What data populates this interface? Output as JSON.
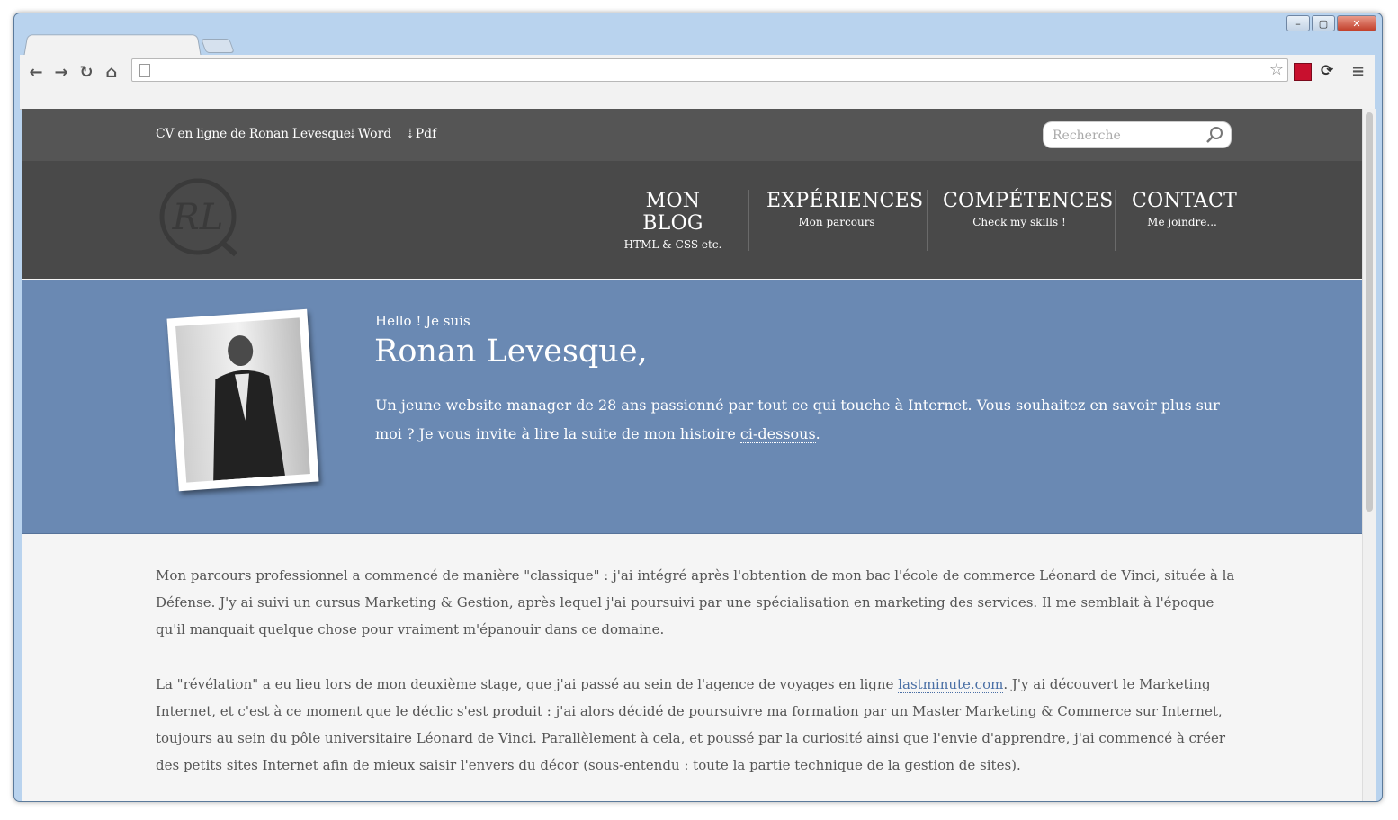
{
  "browser": {
    "window_controls": [
      "–",
      "▢",
      "✕"
    ],
    "url": ""
  },
  "topbar": {
    "cv_title": "CV en ligne de Ronan Levesque",
    "downloads": [
      {
        "label": "Word"
      },
      {
        "label": "Pdf"
      }
    ],
    "search_placeholder": "Recherche"
  },
  "nav": {
    "logo_text": "RL",
    "items": [
      {
        "title": "MON BLOG",
        "subtitle": "HTML & CSS etc."
      },
      {
        "title": "EXPÉRIENCES",
        "subtitle": "Mon parcours"
      },
      {
        "title": "COMPÉTENCES",
        "subtitle": "Check my skills !"
      },
      {
        "title": "CONTACT",
        "subtitle": "Me joindre..."
      }
    ]
  },
  "hero": {
    "greeting": "Hello ! Je suis",
    "name": "Ronan Levesque,",
    "intro_text": "Un jeune website manager de 28 ans passionné par tout ce qui touche à Internet. Vous souhaitez en savoir plus sur moi ? Je vous invite à lire la suite de mon histoire ",
    "intro_link": "ci-dessous",
    "intro_end": "."
  },
  "content": {
    "paragraph1": "Mon parcours professionnel a commencé de manière \"classique\" : j'ai intégré après l'obtention de mon bac l'école de commerce Léonard de Vinci, située à la Défense. J'y ai suivi un cursus Marketing & Gestion, après lequel j'ai poursuivi par une spécialisation en marketing des services. Il me semblait à l'époque qu'il manquait quelque chose pour vraiment m'épanouir dans ce domaine.",
    "paragraph2_start": "La \"révélation\" a eu lieu lors de mon deuxième stage, que j'ai passé au sein de l'agence de voyages en ligne ",
    "paragraph2_link": "lastminute.com",
    "paragraph2_end": ". J'y ai découvert le Marketing Internet, et c'est à ce moment que le déclic s'est produit : j'ai alors décidé de poursuivre ma formation par un Master Marketing & Commerce sur Internet, toujours au sein du pôle universitaire Léonard de Vinci. Parallèlement à cela, et poussé par la curiosité ainsi que l'envie d'apprendre, j'ai commencé à créer des petits sites Internet afin de mieux saisir l'envers du décor (sous-entendu : toute la partie technique de la gestion de sites)."
  },
  "colors": {
    "topbar": "#555555",
    "header": "#494949",
    "hero": "#6a89b3",
    "link": "#4a6fa5"
  }
}
